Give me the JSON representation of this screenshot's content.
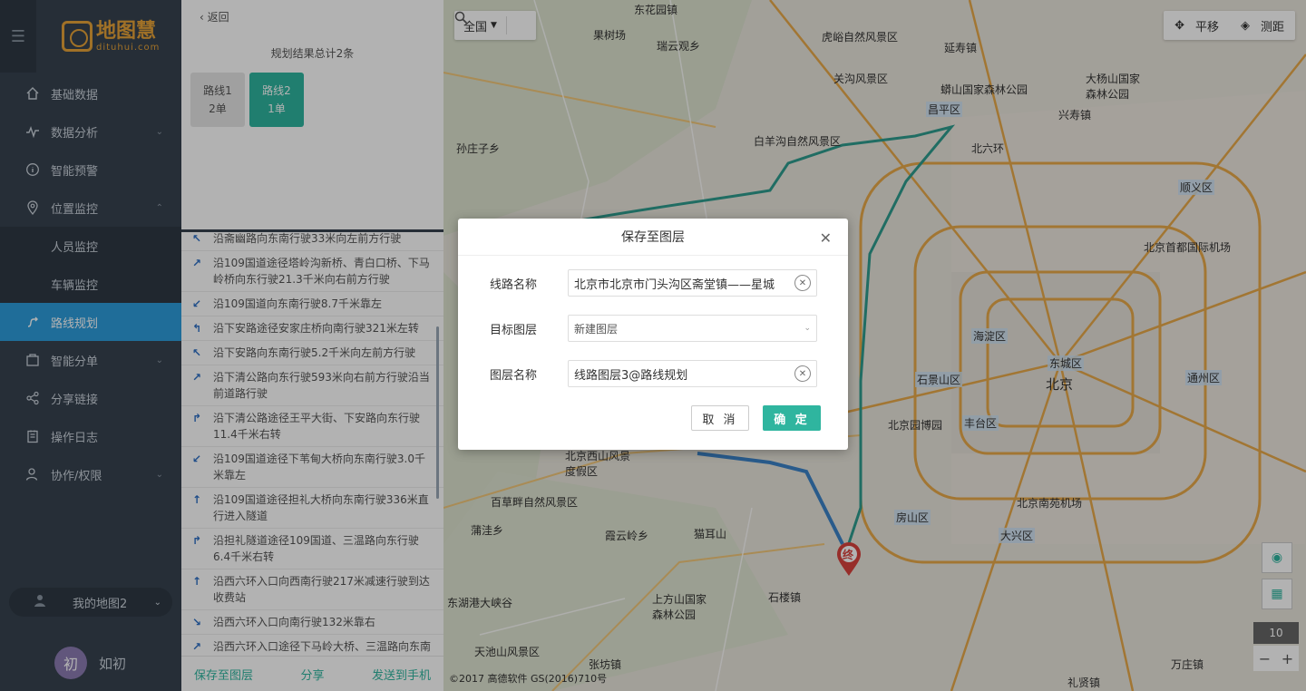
{
  "sidebar": {
    "logo_title": "地图慧",
    "logo_sub": "dituhui.com",
    "items": [
      {
        "label": "基础数据"
      },
      {
        "label": "数据分析"
      },
      {
        "label": "智能预警"
      },
      {
        "label": "位置监控"
      },
      {
        "label": "人员监控"
      },
      {
        "label": "车辆监控"
      },
      {
        "label": "路线规划"
      },
      {
        "label": "智能分单"
      },
      {
        "label": "分享链接"
      },
      {
        "label": "操作日志"
      },
      {
        "label": "协作/权限"
      }
    ],
    "my_map": "我的地图2",
    "user_initial": "初",
    "user_name": "如初"
  },
  "panel": {
    "back": "返回",
    "summary": "规划结果总计2条",
    "routes": [
      {
        "name": "路线1",
        "count": "2单"
      },
      {
        "name": "路线2",
        "count": "1单"
      }
    ],
    "steps": [
      {
        "dir": "↖",
        "text": "沿斋幽路向东南行驶33米向左前方行驶"
      },
      {
        "dir": "↗",
        "text": "沿109国道途径塔岭沟新桥、青白口桥、下马岭桥向东行驶21.3千米向右前方行驶"
      },
      {
        "dir": "↙",
        "text": "沿109国道向东南行驶8.7千米靠左"
      },
      {
        "dir": "↰",
        "text": "沿下安路途径安家庄桥向南行驶321米左转"
      },
      {
        "dir": "↖",
        "text": "沿下安路向东南行驶5.2千米向左前方行驶"
      },
      {
        "dir": "↗",
        "text": "沿下清公路向东行驶593米向右前方行驶沿当前道路行驶"
      },
      {
        "dir": "↱",
        "text": "沿下清公路途径王平大街、下安路向东行驶11.4千米右转"
      },
      {
        "dir": "↙",
        "text": "沿109国道途径下苇甸大桥向东南行驶3.0千米靠左"
      },
      {
        "dir": "↑",
        "text": "沿109国道途径担礼大桥向东南行驶336米直行进入隧道"
      },
      {
        "dir": "↱",
        "text": "沿担礼隧道途径109国道、三温路向东行驶6.4千米右转"
      },
      {
        "dir": "↑",
        "text": "沿西六环入口向西南行驶217米减速行驶到达收费站"
      },
      {
        "dir": "↘",
        "text": "沿西六环入口向南行驶132米靠右"
      },
      {
        "dir": "↗",
        "text": "沿西六环入口途径下马岭大桥、三温路向东南行驶"
      }
    ],
    "footer": {
      "save": "保存至图层",
      "share": "分享",
      "send": "发送到手机"
    }
  },
  "map": {
    "region": "全国",
    "tools": {
      "pan": "平移",
      "measure": "测距"
    },
    "zoom_level": "10",
    "copyright": "©2017 高德软件 GS(2016)710号",
    "labels": [
      {
        "text": "东花园镇",
        "cls": ""
      },
      {
        "text": "果树场",
        "cls": ""
      },
      {
        "text": "瑞云观乡",
        "cls": ""
      },
      {
        "text": "虎峪自然风景区",
        "cls": ""
      },
      {
        "text": "延寿镇",
        "cls": ""
      },
      {
        "text": "关沟风景区",
        "cls": ""
      },
      {
        "text": "大杨山国家森林公园",
        "cls": ""
      },
      {
        "text": "蟒山国家森林公园",
        "cls": ""
      },
      {
        "text": "昌平区",
        "cls": "dist"
      },
      {
        "text": "兴寿镇",
        "cls": ""
      },
      {
        "text": "孙庄子乡",
        "cls": ""
      },
      {
        "text": "白羊沟自然风景区",
        "cls": ""
      },
      {
        "text": "北六环",
        "cls": ""
      },
      {
        "text": "顺义区",
        "cls": "dist"
      },
      {
        "text": "北京首都国际机场",
        "cls": ""
      },
      {
        "text": "海淀区",
        "cls": "dist"
      },
      {
        "text": "东城区",
        "cls": "dist"
      },
      {
        "text": "石景山区",
        "cls": "dist"
      },
      {
        "text": "北京",
        "cls": "city"
      },
      {
        "text": "通州区",
        "cls": "dist"
      },
      {
        "text": "北京园博园",
        "cls": ""
      },
      {
        "text": "丰台区",
        "cls": "dist"
      },
      {
        "text": "北京西山风景度假区",
        "cls": ""
      },
      {
        "text": "百草畔自然风景区",
        "cls": ""
      },
      {
        "text": "北京南苑机场",
        "cls": ""
      },
      {
        "text": "房山区",
        "cls": "dist"
      },
      {
        "text": "猫耳山",
        "cls": ""
      },
      {
        "text": "大兴区",
        "cls": "dist"
      },
      {
        "text": "蒲洼乡",
        "cls": ""
      },
      {
        "text": "霞云岭乡",
        "cls": ""
      },
      {
        "text": "东湖港大峡谷",
        "cls": ""
      },
      {
        "text": "上方山国家森林公园",
        "cls": ""
      },
      {
        "text": "石楼镇",
        "cls": ""
      },
      {
        "text": "天池山风景区",
        "cls": ""
      },
      {
        "text": "张坊镇",
        "cls": ""
      },
      {
        "text": "万庄镇",
        "cls": ""
      },
      {
        "text": "礼贤镇",
        "cls": ""
      }
    ],
    "end_marker": "终"
  },
  "dialog": {
    "title": "保存至图层",
    "fields": {
      "route_name_label": "线路名称",
      "route_name_value": "北京市北京市门头沟区斋堂镇——星城",
      "target_layer_label": "目标图层",
      "target_layer_value": "新建图层",
      "layer_name_label": "图层名称",
      "layer_name_value": "线路图层3@路线规划"
    },
    "cancel": "取 消",
    "ok": "确 定"
  }
}
